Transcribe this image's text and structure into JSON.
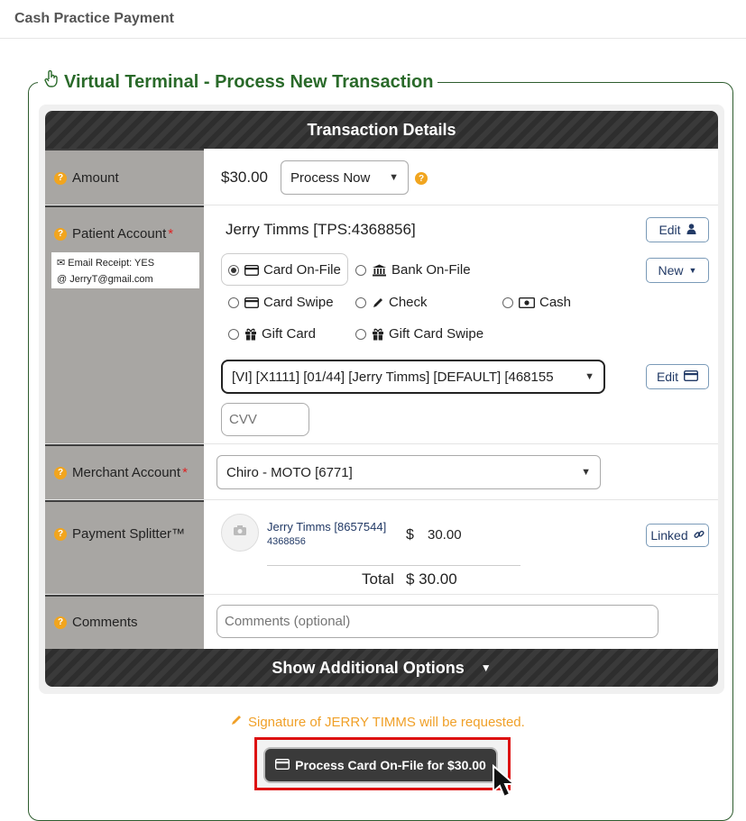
{
  "page_title": "Cash Practice Payment",
  "section_title": "Virtual Terminal - Process New Transaction",
  "transaction_header": "Transaction Details",
  "amount": {
    "label": "Amount",
    "value": "$30.00",
    "timing_selected": "Process Now"
  },
  "patient_account": {
    "label": "Patient Account",
    "required_mark": "*",
    "name": "Jerry Timms [TPS:4368856]",
    "email_receipt": "Email Receipt: YES",
    "email": "JerryT@gmail.com",
    "edit_label": "Edit",
    "new_label": "New",
    "payment_methods": [
      {
        "label": "Card On-File",
        "checked": true,
        "icon": "credit-card-icon"
      },
      {
        "label": "Bank On-File",
        "checked": false,
        "icon": "bank-icon"
      },
      {
        "label": "Card Swipe",
        "checked": false,
        "icon": "credit-card-icon"
      },
      {
        "label": "Check",
        "checked": false,
        "icon": "pencil-icon"
      },
      {
        "label": "Cash",
        "checked": false,
        "icon": "cash-icon"
      },
      {
        "label": "Gift Card",
        "checked": false,
        "icon": "gift-icon"
      },
      {
        "label": "Gift Card Swipe",
        "checked": false,
        "icon": "gift-icon"
      }
    ],
    "card_selected": "[VI] [X1111] [01/44] [Jerry Timms] [DEFAULT] [468155",
    "card_edit_label": "Edit",
    "cvv_placeholder": "CVV"
  },
  "merchant_account": {
    "label": "Merchant Account",
    "required_mark": "*",
    "selected": "Chiro - MOTO [6771]"
  },
  "payment_splitter": {
    "label": "Payment Splitter™",
    "patient_name": "Jerry Timms [8657544]",
    "patient_id": "4368856",
    "currency": "$",
    "amount": "30.00",
    "linked_label": "Linked",
    "total_label": "Total",
    "total_value": "$ 30.00"
  },
  "comments": {
    "label": "Comments",
    "placeholder": "Comments (optional)"
  },
  "additional_options_label": "Show Additional Options",
  "signature_notice": "Signature of JERRY TIMMS will be requested.",
  "process_button_label": "Process Card On-File for $30.00",
  "colors": {
    "section_green": "#2a6a2a",
    "accent_orange": "#f1a51f",
    "highlight_red": "#d11111",
    "dark_bar": "#3a3a3a"
  }
}
